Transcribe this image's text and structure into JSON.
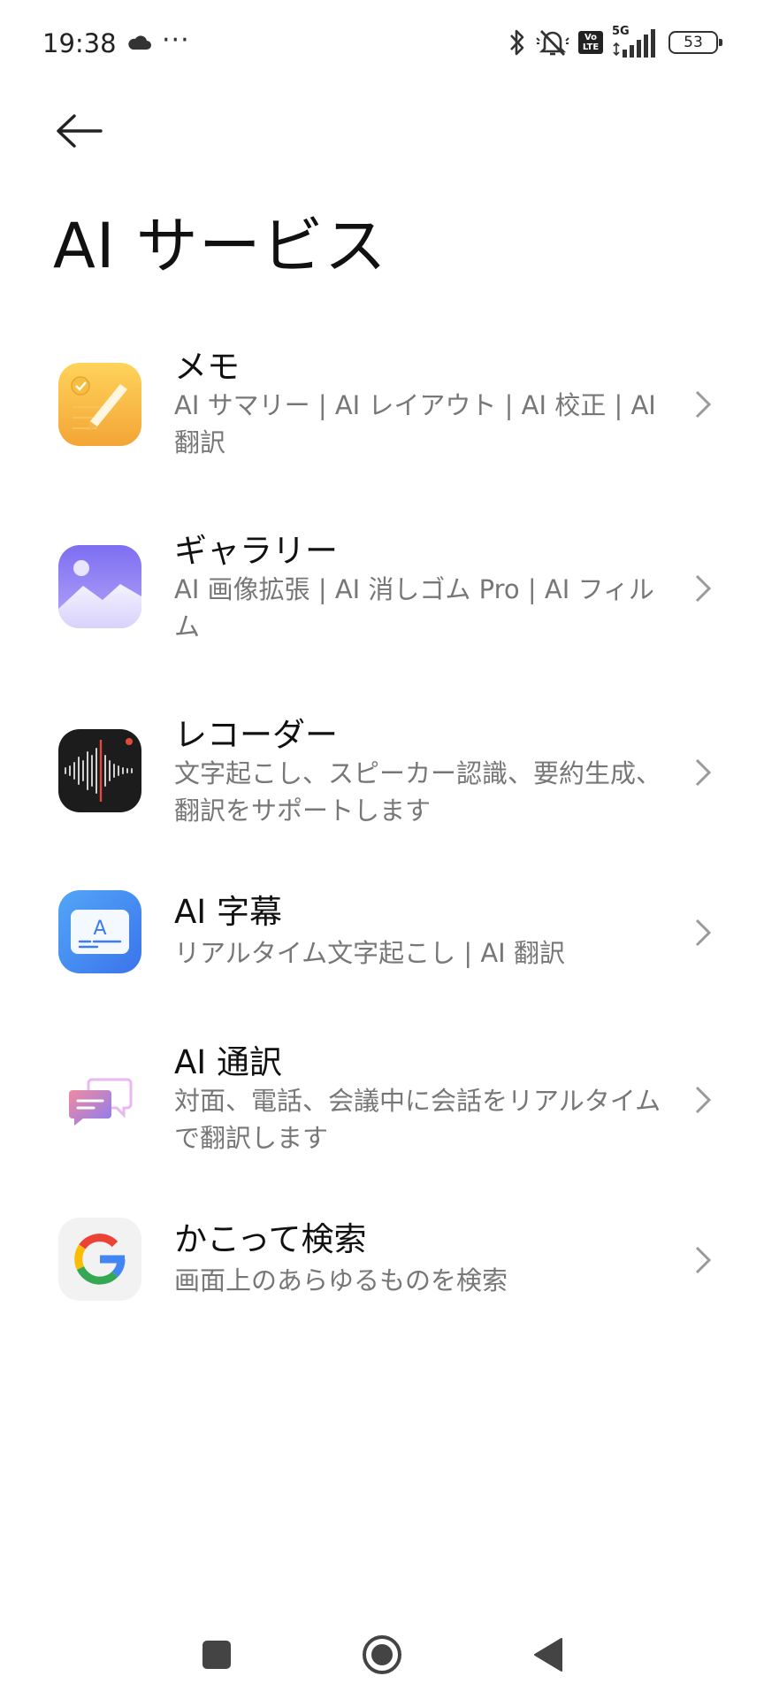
{
  "status_bar": {
    "time": "19:38",
    "overflow": "···",
    "volte_top": "Vo",
    "volte_bottom": "LTE",
    "network": "5G",
    "battery": "53"
  },
  "header": {
    "title": "AI サービス"
  },
  "items": [
    {
      "title": "メモ",
      "subtitle": "AI サマリー | AI レイアウト | AI 校正 | AI 翻訳",
      "icon": "notes-icon"
    },
    {
      "title": "ギャラリー",
      "subtitle": "AI 画像拡張 | AI 消しゴム Pro | AI フィルム",
      "icon": "gallery-icon"
    },
    {
      "title": "レコーダー",
      "subtitle": "文字起こし、スピーカー認識、要約生成、翻訳をサポートします",
      "icon": "recorder-icon"
    },
    {
      "title": "AI 字幕",
      "subtitle": "リアルタイム文字起こし | AI 翻訳",
      "icon": "subtitles-icon"
    },
    {
      "title": "AI 通訳",
      "subtitle": "対面、電話、会議中に会話をリアルタイムで翻訳します",
      "icon": "interpreter-icon"
    },
    {
      "title": "かこって検索",
      "subtitle": "画面上のあらゆるものを検索",
      "icon": "google-icon"
    }
  ],
  "colors": {
    "accent_notes": "#F6B43B",
    "accent_gallery": "#8C84F5",
    "accent_subtitles": "#3C8BF0",
    "google_blue": "#4285F4",
    "google_red": "#EA4335",
    "google_yellow": "#FBBC05",
    "google_green": "#34A853"
  }
}
